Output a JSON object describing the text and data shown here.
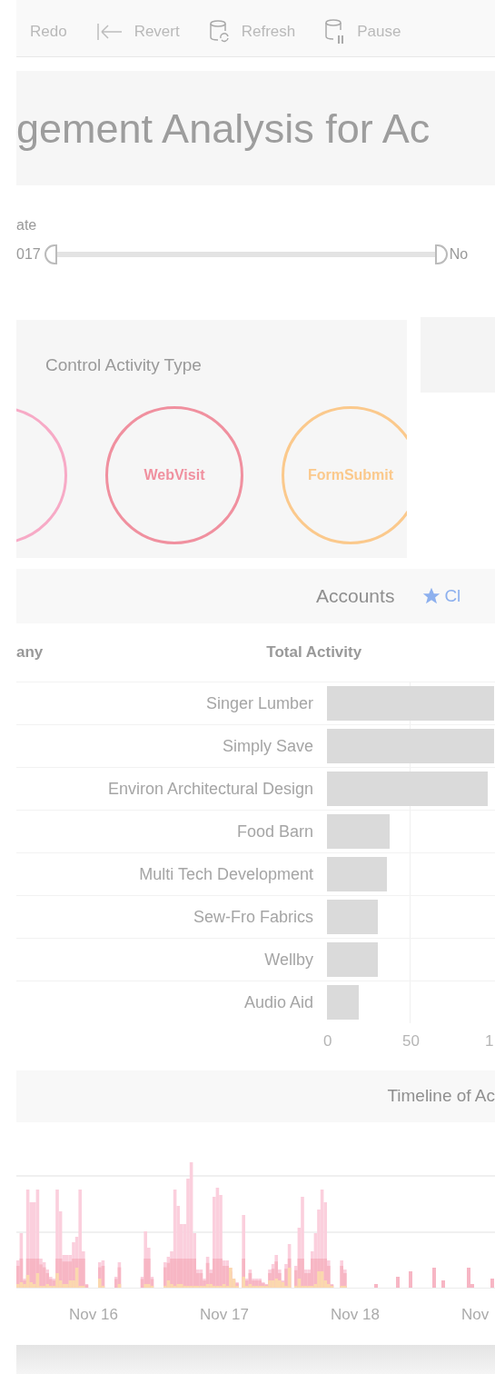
{
  "toolbar": {
    "items": [
      {
        "label": "Redo",
        "kind": "text"
      },
      {
        "label": "Revert",
        "kind": "revert"
      },
      {
        "label": "Refresh",
        "kind": "refresh"
      },
      {
        "label": "Pause",
        "kind": "pause"
      }
    ]
  },
  "title": "gement Analysis for Ac",
  "date_filter": {
    "label": "ate",
    "start": "017",
    "end": "No",
    "level": 1
  },
  "activity_type": {
    "title": "Control Activity Type",
    "items": [
      {
        "color": "#f7aac6"
      },
      {
        "label": "WebVisit",
        "color": "#f0909f"
      },
      {
        "label": "FormSubmit",
        "color": "#fbc98c"
      }
    ]
  },
  "accounts": {
    "title": "Accounts",
    "link": "Cl",
    "columns": [
      "any",
      "Total Activity"
    ],
    "chart_data": {
      "type": "bar",
      "orientation": "horizontal",
      "categories": [
        "Singer Lumber",
        "Simply Save",
        "Environ Architectural Design",
        "Food Barn",
        "Multi Tech Development",
        "Sew-Fro Fabrics",
        "Wellby",
        "Audio Aid"
      ],
      "values": [
        101,
        101,
        97,
        38,
        36,
        31,
        31,
        19
      ],
      "xlim": [
        0,
        101
      ],
      "xticks": [
        0,
        50
      ]
    },
    "axis_edge_label": "1"
  },
  "timeline": {
    "title": "Timeline of Ac",
    "xlabels": [
      "Nov 16",
      "Nov 17",
      "Nov 18",
      "Nov"
    ]
  }
}
